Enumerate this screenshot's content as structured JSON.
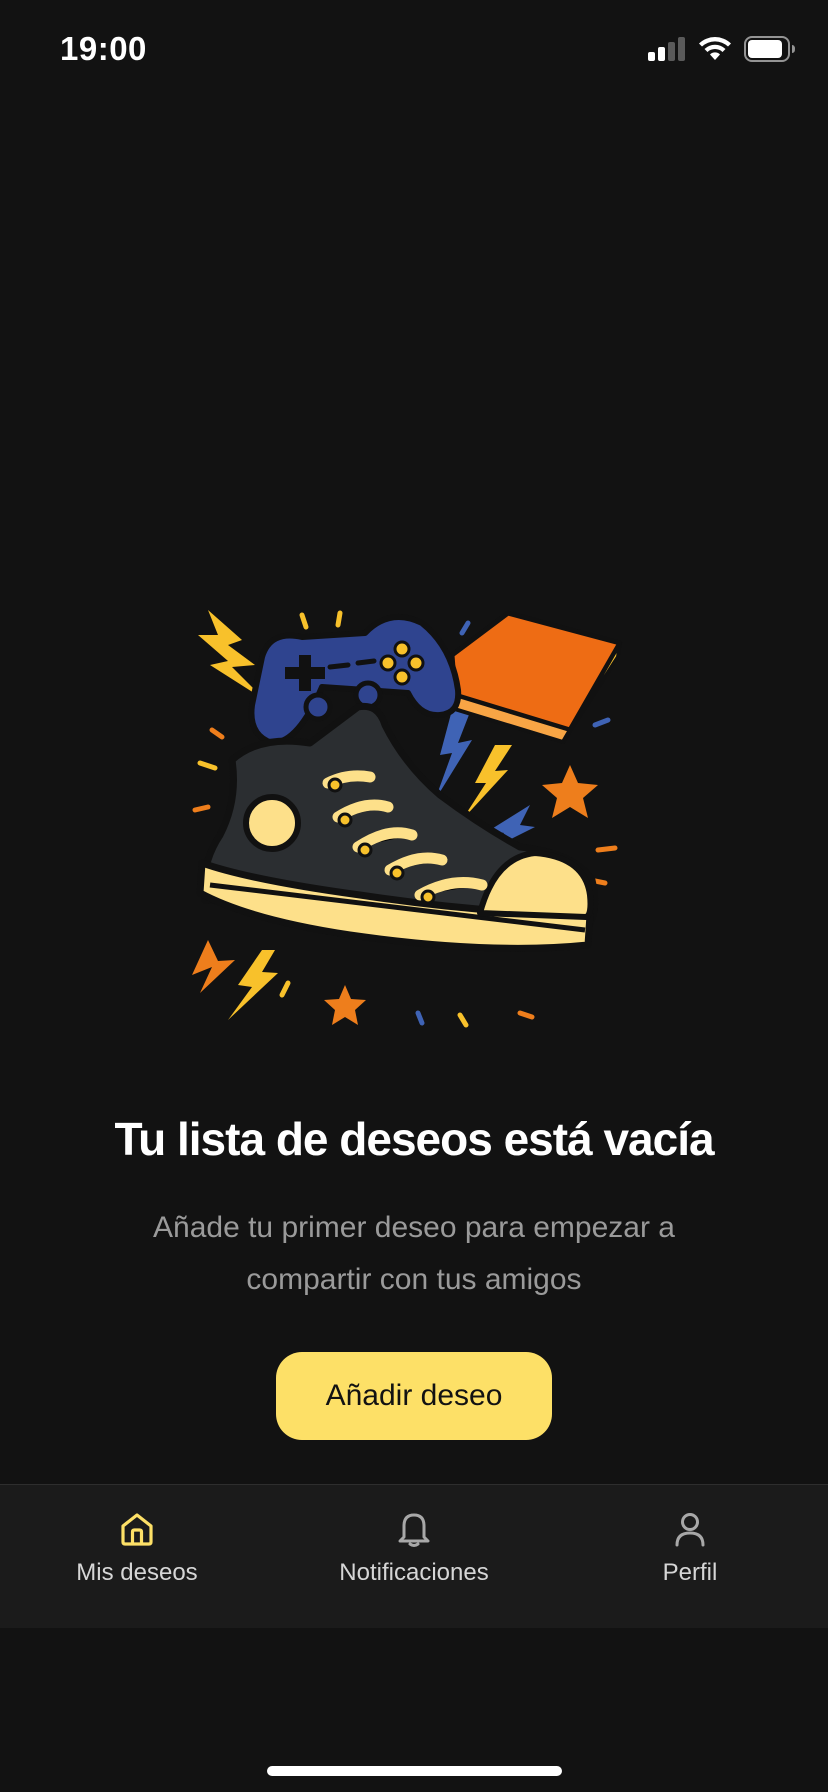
{
  "status_bar": {
    "time": "19:00"
  },
  "empty_state": {
    "title": "Tu lista de deseos está vacía",
    "subtitle": "Añade tu primer deseo para empezar a compartir con tus amigos",
    "button_label": "Añadir deseo"
  },
  "tab_bar": {
    "items": [
      {
        "label": "Mis deseos",
        "icon": "home-icon",
        "active": true
      },
      {
        "label": "Notificaciones",
        "icon": "bell-icon",
        "active": false
      },
      {
        "label": "Perfil",
        "icon": "person-icon",
        "active": false
      }
    ]
  },
  "colors": {
    "background": "#121212",
    "accent": "#fde067",
    "tab_bar": "#1b1b1b",
    "subtitle": "#9a9a9a"
  }
}
